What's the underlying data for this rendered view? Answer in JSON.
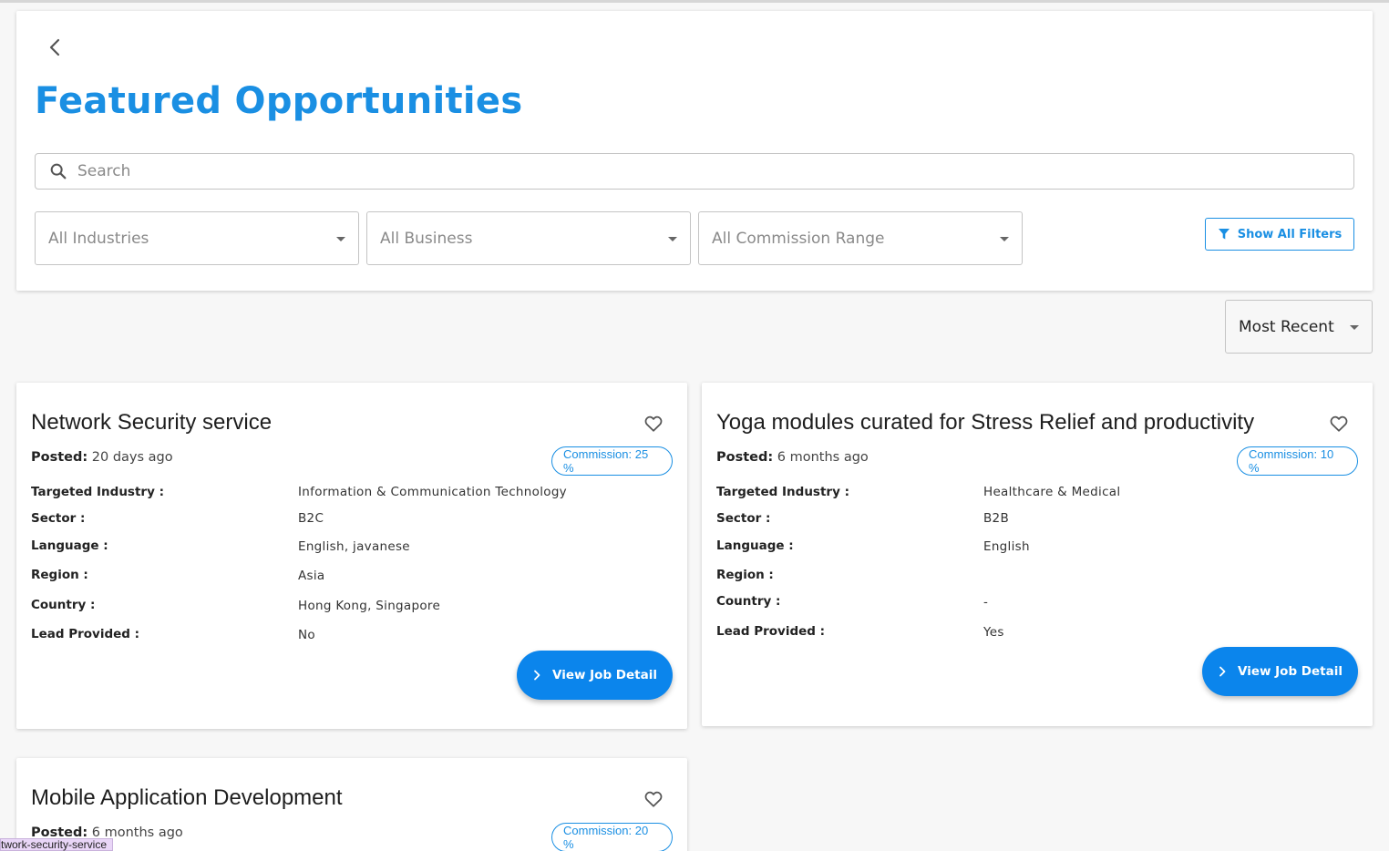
{
  "page": {
    "title": "Featured Opportunities"
  },
  "search": {
    "placeholder": "Search",
    "value": ""
  },
  "filters": {
    "industries": "All Industries",
    "business": "All Business",
    "commission_range": "All Commission Range",
    "show_all_label": "Show All Filters"
  },
  "sort": {
    "selected": "Most Recent"
  },
  "labels": {
    "posted": "Posted:",
    "targeted_industry": "Targeted Industry :",
    "sector": "Sector :",
    "language": "Language :",
    "region": "Region :",
    "country": "Country :",
    "lead_provided": "Lead Provided :",
    "view_job_detail": "View Job Detail"
  },
  "cards": [
    {
      "title": "Network Security service",
      "posted": "20 days ago",
      "commission": "Commission: 25 %",
      "targeted_industry": "Information & Communication Technology",
      "sector": "B2C",
      "language": "English, javanese",
      "region": "Asia",
      "country": "Hong Kong, Singapore",
      "lead_provided": "No"
    },
    {
      "title": "Yoga modules curated for Stress Relief and productivity",
      "posted": "6 months ago",
      "commission": "Commission: 10 %",
      "targeted_industry": "Healthcare & Medical",
      "sector": "B2B",
      "language": "English",
      "region": "",
      "country": "-",
      "lead_provided": "Yes"
    },
    {
      "title": "Mobile Application Development",
      "posted": "6 months ago",
      "commission": "Commission: 20 %"
    }
  ],
  "status_url": "twork-security-service",
  "colors": {
    "accent": "#1a8fe3",
    "button": "#0b85ec",
    "background": "#f7f7f7"
  }
}
